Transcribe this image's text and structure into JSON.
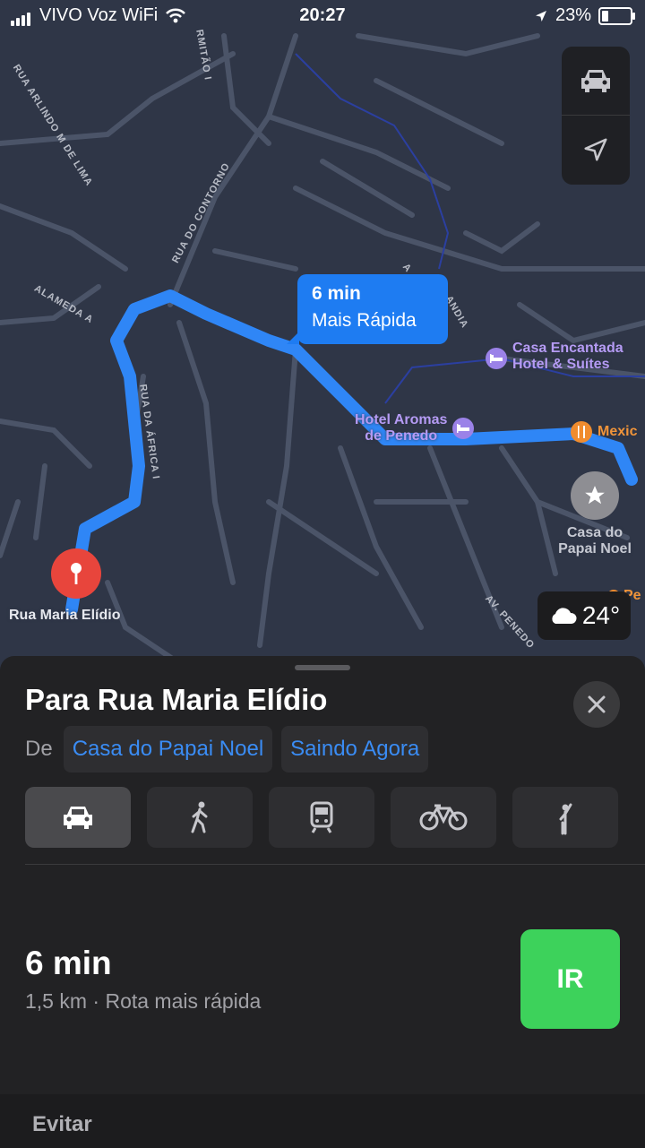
{
  "status_bar": {
    "carrier": "VIVO Voz WiFi",
    "time": "20:27",
    "battery": "23%"
  },
  "map": {
    "callout": {
      "time": "6 min",
      "label": "Mais Rápida"
    },
    "destination_label": "Rua Maria Elídio",
    "streets": [
      "RUA ARLINDO M DE LIMA",
      "RMITÃO I",
      "RUA DO CONTORNO",
      "ALAMEDA A",
      "RUA DA ÁFRICA I",
      "AV. PENEDO",
      "A",
      "ANDIA"
    ],
    "pois": [
      {
        "name": "Casa Encantada\nHotel & Suítes",
        "kind": "hotel",
        "color": "#b59bf4"
      },
      {
        "name": "Hotel Aromas\nde Penedo",
        "kind": "hotel",
        "color": "#b59bf4"
      },
      {
        "name": "Mexic",
        "kind": "restaurant",
        "color": "#f0943a"
      },
      {
        "name": "Casa do\nPapai Noel",
        "kind": "favorite",
        "color": "#c6c9d2"
      },
      {
        "name": "Pe",
        "kind": "restaurant",
        "color": "#f0943a"
      }
    ],
    "weather": {
      "icon": "cloud-icon",
      "temp": "24°"
    },
    "route_color": "#2f86f6"
  },
  "sheet": {
    "title": "Para Rua Maria Elídio",
    "from_label": "De",
    "origin_chip": "Casa do Papai Noel",
    "time_chip": "Saindo Agora",
    "modes": [
      "car-icon",
      "walk-icon",
      "transit-icon",
      "bike-icon",
      "ride-icon"
    ],
    "active_mode": "car-icon",
    "route": {
      "time": "6 min",
      "details": "1,5 km · Rota mais rápida"
    },
    "go_label": "IR",
    "go_color": "#3dd25b",
    "avoid_label": "Evitar"
  }
}
